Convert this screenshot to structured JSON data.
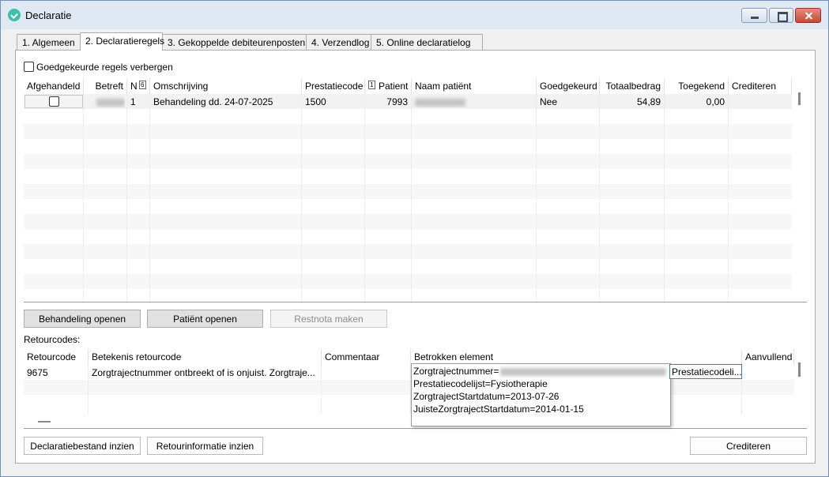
{
  "window": {
    "title": "Declaratie",
    "icon": "heart-icon"
  },
  "tabs": [
    {
      "label": "1. Algemeen"
    },
    {
      "label": "2. Declaratieregels"
    },
    {
      "label": "3. Gekoppelde debiteurenposten"
    },
    {
      "label": "4. Verzendlog"
    },
    {
      "label": "5. Online declaratielog"
    }
  ],
  "filter": {
    "hide_approved_label": "Goedgekeurde regels verbergen",
    "hide_approved_checked": false
  },
  "lines_table": {
    "columns": {
      "afgehandeld": "Afgehandeld",
      "betreft": "Betreft",
      "n": "N",
      "n_sort_indicator": "6",
      "omschrijving": "Omschrijving",
      "prestatiecode": "Prestatiecode",
      "patient_sort_indicator": "1",
      "patient": "Patient",
      "naam_patient": "Naam patiënt",
      "goedgekeurd": "Goedgekeurd",
      "totaalbedrag": "Totaalbedrag",
      "toegekend": "Toegekend",
      "crediteren": "Crediteren"
    },
    "rows": [
      {
        "afgehandeld": false,
        "n": "1",
        "omschrijving": "Behandeling dd. 24-07-2025",
        "prestatiecode": "1500",
        "patient": "7993",
        "goedgekeurd": "Nee",
        "totaalbedrag": "54,89",
        "toegekend": "0,00",
        "crediteren": ""
      }
    ]
  },
  "line_actions": {
    "open_treatment": "Behandeling openen",
    "open_patient": "Patiënt openen",
    "make_restnota": "Restnota maken"
  },
  "retourcodes": {
    "label": "Retourcodes:",
    "columns": {
      "retourcode": "Retourcode",
      "betekenis": "Betekenis retourcode",
      "commentaar": "Commentaar",
      "betrokken_element": "Betrokken element",
      "aanvullend": "Aanvullend"
    },
    "rows": [
      {
        "retourcode": "9675",
        "betekenis": "Zorgtrajectnummer ontbreekt of is onjuist. Zorgtraje...",
        "commentaar": "",
        "betrokken_element_selected": "Prestatiecodeli..."
      }
    ],
    "element_popup": [
      "Zorgtrajectnummer=",
      "Prestatiecodelijst=Fysiotherapie",
      "ZorgtrajectStartdatum=2013-07-26",
      "JuisteZorgtrajectStartdatum=2014-01-15"
    ]
  },
  "footer": {
    "view_declaration_file": "Declaratiebestand inzien",
    "view_return_info": "Retourinformatie inzien",
    "credit": "Crediteren"
  }
}
